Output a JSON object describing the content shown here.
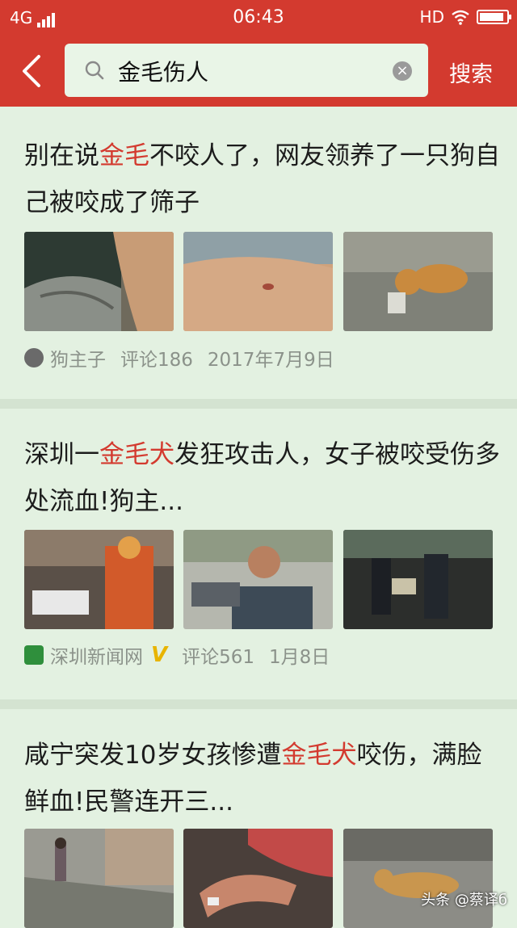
{
  "status": {
    "network": "4G",
    "time": "06:43",
    "hd": "HD",
    "battery_level": 0.9
  },
  "search": {
    "query": "金毛伤人",
    "search_button": "搜索",
    "back_icon": "back-arrow-icon",
    "clear_icon": "clear-icon"
  },
  "articles": [
    {
      "title_parts": [
        "别在说",
        "金毛",
        "不咬人了，网友领养了一只狗自己被咬成了筛子"
      ],
      "highlight": "金毛",
      "source": "狗主子",
      "comments": "评论186",
      "date": "2017年7月9日",
      "verified": false
    },
    {
      "title_parts": [
        "深圳一",
        "金毛犬",
        "发狂攻击人，女子被咬受伤多处流血!狗主..."
      ],
      "highlight": "金毛犬",
      "source": "深圳新闻网",
      "comments": "评论561",
      "date": "1月8日",
      "verified": true,
      "verified_mark": "V"
    },
    {
      "title_parts": [
        "咸宁突发10岁女孩惨遭",
        "金毛犬",
        "咬伤，满脸鲜血!民警连开三..."
      ],
      "highlight": "金毛犬",
      "verified": false
    }
  ],
  "watermark": "头条 @蔡译б",
  "colors": {
    "header": "#d33a2f",
    "background": "#e3f1e1",
    "highlight": "#d33a2f",
    "meta": "#8b928a"
  }
}
